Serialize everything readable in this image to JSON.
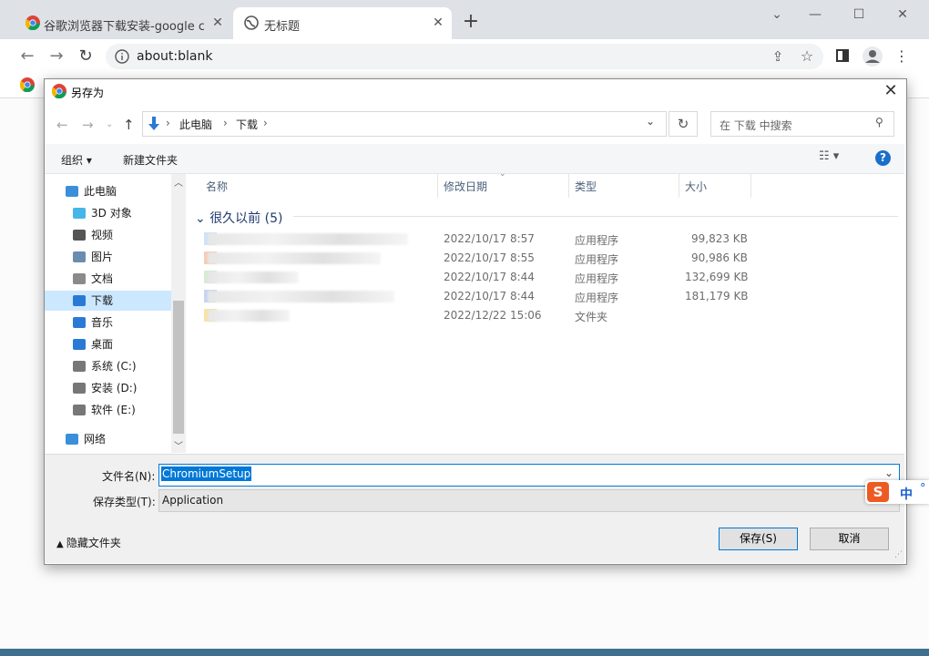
{
  "browser": {
    "tabs": [
      {
        "title": "谷歌浏览器下载安装-google chrome"
      },
      {
        "title": "无标题"
      }
    ],
    "new_tab": "+",
    "url": "about:blank"
  },
  "dialog": {
    "title": "另存为",
    "breadcrumb": [
      "此电脑",
      "下载"
    ],
    "search_placeholder": "在 下载 中搜索",
    "toolbar": {
      "organize": "组织 ▾",
      "new_folder": "新建文件夹"
    },
    "nav": [
      {
        "label": "此电脑",
        "icon": "computer-icon",
        "color": "#3b8fd8"
      },
      {
        "label": "3D 对象",
        "icon": "cube-icon",
        "color": "#46b6e8"
      },
      {
        "label": "视频",
        "icon": "video-icon",
        "color": "#555555"
      },
      {
        "label": "图片",
        "icon": "picture-icon",
        "color": "#6a8caf"
      },
      {
        "label": "文档",
        "icon": "document-icon",
        "color": "#8a8a8a"
      },
      {
        "label": "下载",
        "icon": "download-icon",
        "color": "#2a7ad5"
      },
      {
        "label": "音乐",
        "icon": "music-icon",
        "color": "#2a7ad5"
      },
      {
        "label": "桌面",
        "icon": "desktop-icon",
        "color": "#2a7ad5"
      },
      {
        "label": "系统 (C:)",
        "icon": "drive-icon",
        "color": "#777777"
      },
      {
        "label": "安装 (D:)",
        "icon": "drive-icon",
        "color": "#777777"
      },
      {
        "label": "软件 (E:)",
        "icon": "drive-icon",
        "color": "#777777"
      },
      {
        "label": "网络",
        "icon": "network-icon",
        "color": "#3b8fd8"
      }
    ],
    "columns": {
      "name": "名称",
      "date": "修改日期",
      "type": "类型",
      "size": "大小"
    },
    "group": "很久以前 (5)",
    "files": [
      {
        "date": "2022/10/17 8:57",
        "type": "应用程序",
        "size": "99,823 KB",
        "color": "#cfe3f7"
      },
      {
        "date": "2022/10/17 8:55",
        "type": "应用程序",
        "size": "90,986 KB",
        "color": "#f6cdb8"
      },
      {
        "date": "2022/10/17 8:44",
        "type": "应用程序",
        "size": "132,699 KB",
        "color": "#d6ecd2"
      },
      {
        "date": "2022/10/17 8:44",
        "type": "应用程序",
        "size": "181,179 KB",
        "color": "#c6d5f3"
      },
      {
        "date": "2022/12/22 15:06",
        "type": "文件夹",
        "size": "",
        "color": "#f7e3a4"
      }
    ],
    "filename_label": "文件名(N):",
    "filename_value": "ChromiumSetup",
    "filetype_label": "保存类型(T):",
    "filetype_value": "Application",
    "hide_folders": "隐藏文件夹",
    "save": "保存(S)",
    "cancel": "取消"
  },
  "ime": {
    "label": "中",
    "dot": "°"
  },
  "colors": {
    "accent": "#0078d7",
    "tabstrip": "#dee1e6"
  }
}
